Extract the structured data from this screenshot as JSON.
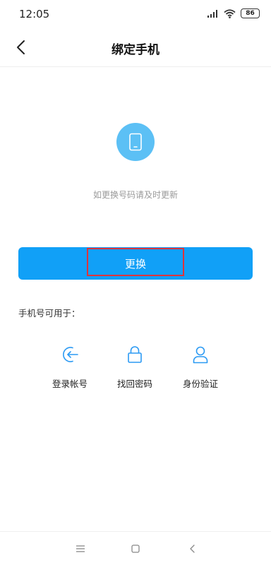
{
  "status_bar": {
    "time": "12:05",
    "battery": "86",
    "icons": [
      "signal-icon",
      "wifi-icon",
      "battery-icon"
    ]
  },
  "header": {
    "title": "绑定手机",
    "back_icon": "chevron-left-icon"
  },
  "main": {
    "phone_icon": "phone-icon",
    "hint": "如更换号码请及时更新",
    "change_button": "更换",
    "uses_label": "手机号可用于：",
    "features": [
      {
        "icon": "login-icon",
        "label": "登录帐号"
      },
      {
        "icon": "lock-icon",
        "label": "找回密码"
      },
      {
        "icon": "user-icon",
        "label": "身份验证"
      }
    ]
  },
  "nav_bar": {
    "icons": [
      "menu-icon",
      "home-icon",
      "back-icon"
    ]
  },
  "colors": {
    "accent": "#11a0f7",
    "icon_blue": "#2b9af3",
    "circle": "#5cc0f5",
    "highlight": "#e0333a"
  }
}
